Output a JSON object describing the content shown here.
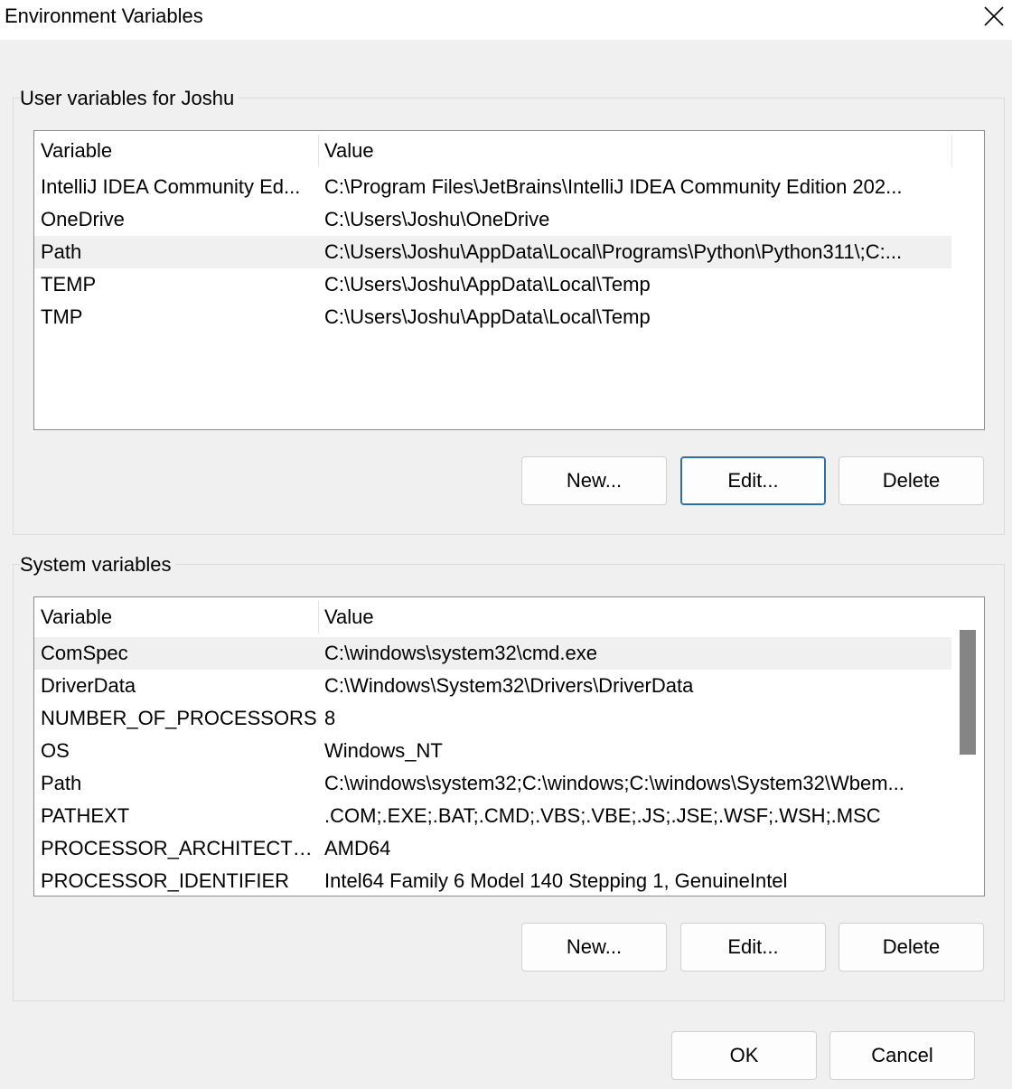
{
  "window": {
    "title": "Environment Variables"
  },
  "user_group": {
    "label": "User variables for Joshu",
    "columns": {
      "variable": "Variable",
      "value": "Value"
    },
    "rows": [
      {
        "variable": "IntelliJ IDEA Community Ed...",
        "value": "C:\\Program Files\\JetBrains\\IntelliJ IDEA Community Edition 202..."
      },
      {
        "variable": "OneDrive",
        "value": "C:\\Users\\Joshu\\OneDrive"
      },
      {
        "variable": "Path",
        "value": "C:\\Users\\Joshu\\AppData\\Local\\Programs\\Python\\Python311\\;C:..."
      },
      {
        "variable": "TEMP",
        "value": "C:\\Users\\Joshu\\AppData\\Local\\Temp"
      },
      {
        "variable": "TMP",
        "value": "C:\\Users\\Joshu\\AppData\\Local\\Temp"
      }
    ],
    "selected_row": "Path",
    "buttons": {
      "new": "New...",
      "edit": "Edit...",
      "delete": "Delete"
    }
  },
  "system_group": {
    "label": "System variables",
    "columns": {
      "variable": "Variable",
      "value": "Value"
    },
    "rows": [
      {
        "variable": "ComSpec",
        "value": "C:\\windows\\system32\\cmd.exe"
      },
      {
        "variable": "DriverData",
        "value": "C:\\Windows\\System32\\Drivers\\DriverData"
      },
      {
        "variable": "NUMBER_OF_PROCESSORS",
        "value": "8"
      },
      {
        "variable": "OS",
        "value": "Windows_NT"
      },
      {
        "variable": "Path",
        "value": "C:\\windows\\system32;C:\\windows;C:\\windows\\System32\\Wbem..."
      },
      {
        "variable": "PATHEXT",
        "value": ".COM;.EXE;.BAT;.CMD;.VBS;.VBE;.JS;.JSE;.WSF;.WSH;.MSC"
      },
      {
        "variable": "PROCESSOR_ARCHITECTURE",
        "value": "AMD64"
      },
      {
        "variable": "PROCESSOR_IDENTIFIER",
        "value": "Intel64 Family 6 Model 140 Stepping 1, GenuineIntel"
      }
    ],
    "selected_row": "ComSpec",
    "buttons": {
      "new": "New...",
      "edit": "Edit...",
      "delete": "Delete"
    }
  },
  "footer": {
    "ok": "OK",
    "cancel": "Cancel"
  },
  "icons": {
    "close": "close-icon"
  },
  "colors": {
    "window_bg": "#f0f0f0",
    "title_bg": "#ffffff",
    "list_bg": "#ffffff",
    "selected_row_bg": "#f0f0f0",
    "focus_border": "#2b6ea8",
    "scroll_thumb": "#858585"
  }
}
